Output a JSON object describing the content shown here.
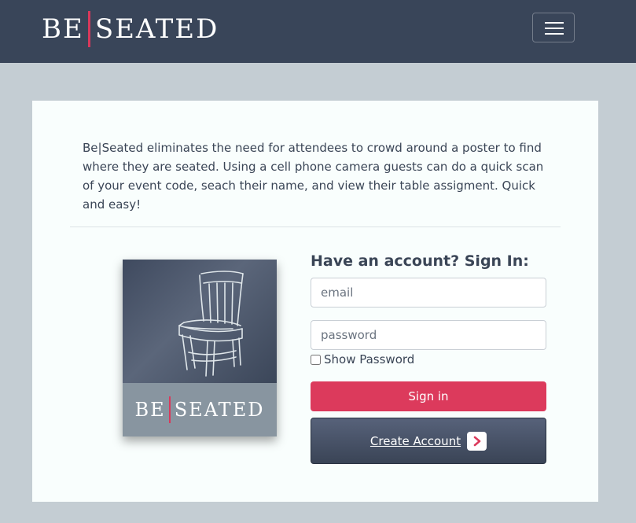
{
  "header": {
    "brand_left": "BE",
    "brand_right": "SEATED",
    "menu_icon": "hamburger-menu-icon"
  },
  "intro": {
    "text": "Be|Seated eliminates the need for attendees to crowd around a poster to find where they are seated. Using a cell phone camera guests can do a quick scan of your event code, seach their name, and view their table assigment. Quick and easy!"
  },
  "promo": {
    "illustration": "chair-icon",
    "brand_left": "BE",
    "brand_right": "SEATED"
  },
  "signin": {
    "title": "Have an account? Sign In:",
    "email_placeholder": "email",
    "email_value": "",
    "password_placeholder": "password",
    "password_value": "",
    "show_password_label": "Show Password",
    "show_password_checked": false,
    "signin_label": "Sign in",
    "create_account_label": "Create Account",
    "create_account_icon": "chevron-right-icon"
  },
  "colors": {
    "navbar": "#394559",
    "page_background": "#c4cdd3",
    "accent": "#dc3a5c",
    "card": "#f9fefd"
  }
}
